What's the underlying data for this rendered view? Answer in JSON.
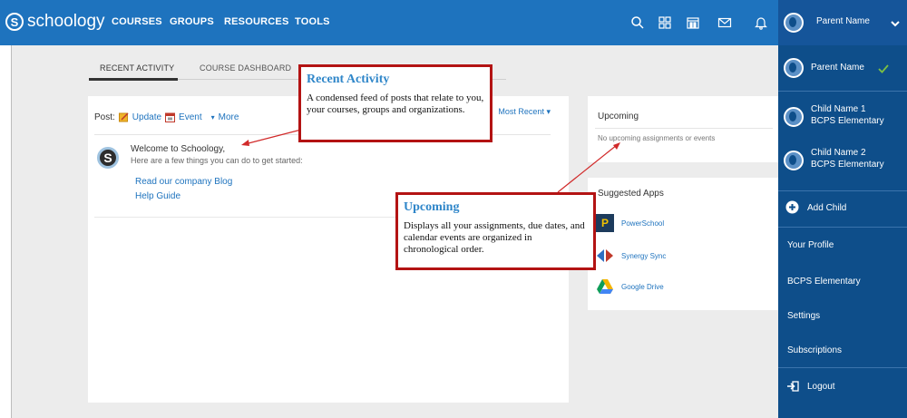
{
  "header": {
    "logo_text": "schoology",
    "logo_mark": "S",
    "nav": [
      "COURSES",
      "GROUPS",
      "RESOURCES",
      "TOOLS"
    ]
  },
  "icons": {
    "search": "search-icon",
    "apps": "apps-grid-icon",
    "calendar": "calendar-icon",
    "mail": "mail-icon",
    "notifications": "bell-icon"
  },
  "tabs": {
    "recent_activity": "RECENT ACTIVITY",
    "course_dashboard": "COURSE DASHBOARD"
  },
  "feed": {
    "post_label": "Post:",
    "update": "Update",
    "event": "Event",
    "more": "More",
    "sort": "Most Recent",
    "welcome_title": "Welcome to Schoology,",
    "welcome_sub": "Here are a few things you can do to get started:",
    "links": [
      "Read our company Blog",
      "Help Guide"
    ]
  },
  "upcoming": {
    "title": "Upcoming",
    "empty": "No upcoming assignments or events"
  },
  "suggested_apps": {
    "title": "Suggested Apps",
    "apps": [
      "PowerSchool",
      "Synergy Sync",
      "Google Drive"
    ]
  },
  "callouts": {
    "recent": {
      "title": "Recent Activity",
      "body": "A condensed feed of posts that relate to you, your courses, groups and organizations."
    },
    "upcoming": {
      "title": "Upcoming",
      "body": "Displays all your assignments, due dates, and calendar events are organized in chronological order."
    }
  },
  "account_menu": {
    "current_user": "Parent Name",
    "parent": "Parent Name",
    "children": [
      {
        "name": "Child Name 1",
        "school": "BCPS Elementary"
      },
      {
        "name": "Child Name 2",
        "school": "BCPS Elementary"
      }
    ],
    "add_child": "Add Child",
    "your_profile": "Your Profile",
    "school": "BCPS Elementary",
    "settings": "Settings",
    "subscriptions": "Subscriptions",
    "logout": "Logout"
  },
  "colors": {
    "brand_blue": "#1e73be",
    "menu_blue": "#0e4e8a",
    "callout_border": "#b31313",
    "check_green": "#7bc043"
  }
}
